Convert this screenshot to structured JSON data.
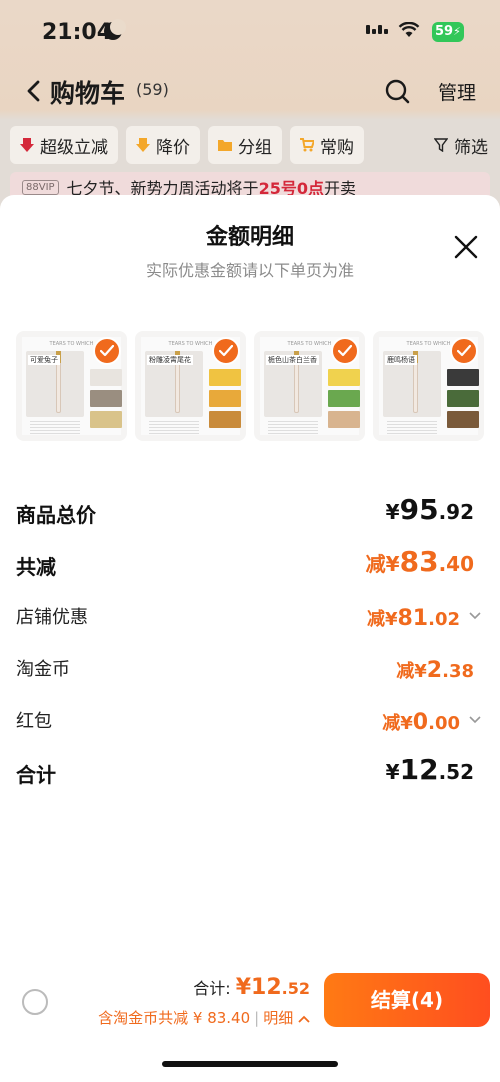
{
  "status_bar": {
    "time": "21:04",
    "battery": "59"
  },
  "navbar": {
    "title": "购物车",
    "count": "(59)",
    "manage": "管理"
  },
  "filters": [
    "超级立减",
    "降价",
    "分组",
    "常购",
    "筛选"
  ],
  "banner": {
    "vip": "88VIP",
    "text_prefix": "七夕节、新势力周活动将于",
    "highlight": "25号0点",
    "text_suffix": "开卖"
  },
  "sheet": {
    "title": "金额明细",
    "subtitle": "实际优惠金额请以下单页为准",
    "products": [
      {
        "label": "可爱兔子",
        "header": "TEARS TO WHICH",
        "colors": [
          "#e8e4df",
          "#9a8e80",
          "#d9c38a"
        ]
      },
      {
        "label": "粉雕凌霄尾花",
        "header": "TEARS TO WHICH",
        "colors": [
          "#f0c341",
          "#e8a93a",
          "#c98b3b"
        ]
      },
      {
        "label": "栀色山茶白兰香",
        "header": "TEARS TO WHICH",
        "colors": [
          "#f0d24e",
          "#6aa84f",
          "#d8b48f"
        ]
      },
      {
        "label": "鹿鸣杨语",
        "header": "TEARS TO WHICH",
        "colors": [
          "#3a3a3a",
          "#4a6b3a",
          "#7a5a3a"
        ]
      }
    ],
    "rows": [
      {
        "label": "商品总价",
        "yen": "¥",
        "int": "95",
        "dec": ".92"
      },
      {
        "label": "共减",
        "prefix": "减¥",
        "int": "83",
        "dec": ".40"
      },
      {
        "label": "店铺优惠",
        "prefix": "减¥",
        "int": "81",
        "dec": ".02"
      },
      {
        "label": "淘金币",
        "prefix": "减¥",
        "int": "2",
        "dec": ".38"
      },
      {
        "label": "红包",
        "prefix": "减¥",
        "int": "0",
        "dec": ".00"
      },
      {
        "label": "合计",
        "yen": "¥",
        "int": "12",
        "dec": ".52"
      }
    ]
  },
  "footer": {
    "total_label": "合计: ",
    "total_yen": "¥",
    "total_int": "12",
    "total_dec": ".52",
    "coin_note": "含淘金币共减 ¥ 83.40",
    "separator": "|",
    "detail": "明细",
    "checkout": "结算(4)"
  },
  "colors": {
    "accent": "#f06a1d",
    "highlight_red": "#d4283a"
  }
}
